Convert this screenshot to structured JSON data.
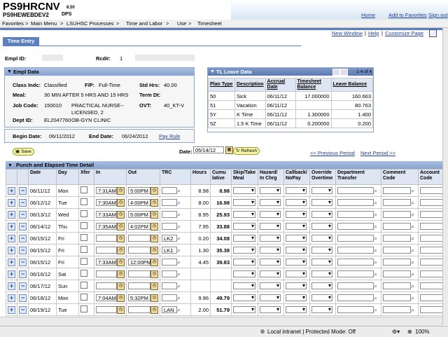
{
  "header": {
    "title": "PS9HRCNV",
    "version": "8.50",
    "database": "PS9HEWEBDEV2",
    "env": "DPS",
    "links": [
      "Home",
      "Add to Favorites",
      "Sign out"
    ]
  },
  "nav": {
    "crumbs": [
      "Favorites",
      "Main Menu",
      "LSUHSC Processes",
      "Time and Labor",
      "Use",
      "Timesheet"
    ],
    "separator": ">"
  },
  "page": {
    "tab_label": "Time Entry",
    "links": [
      "New Window",
      "Help",
      "Customize Page"
    ],
    "empl_id_label": "Empl ID:",
    "rcd_label": "Rcd#:",
    "rcd_value": "1"
  },
  "empl_data": {
    "title": "Empl Data",
    "class_label": "Class Indc:",
    "class_value": "Classified",
    "fp_label": "F/P:",
    "fp_value": "Full-Time",
    "std_label": "Std Hrs:",
    "std_value": "40.00",
    "meal_label": "Meal:",
    "meal_value": "30 MIN AFTER 5 HRS AND 15 HRS",
    "term_label": "Term Dt:",
    "job_label": "Job Code:",
    "job_code": "150010",
    "job_desc_1": "PRACTICAL NURSE--",
    "job_desc_2": "LICENSED, 2",
    "ovt_label": "OVT:",
    "ovt_value": "40_KT-V",
    "dept_label": "Dept ID:",
    "dept_code": "EL2047760",
    "dept_desc": "OB-GYN CLINIC"
  },
  "period": {
    "begin_label": "Begin Date:",
    "begin_value": "06/11/2012",
    "end_label": "End Date:",
    "end_value": "06/24/2012",
    "payrule_link": "Pay Rule"
  },
  "leave": {
    "title": "TL Leave Data",
    "pager": "1-4 of 4",
    "headers": [
      "Plan Type",
      "Description",
      "Accrual Date",
      "Timesheet Balance",
      "Leave Balance"
    ],
    "rows": [
      [
        "50",
        "Sick",
        "06/11/12",
        "17.000000",
        "160.663"
      ],
      [
        "51",
        "Vacation",
        "06/11/12",
        "",
        "80.763"
      ],
      [
        "5Y",
        "K Time",
        "06/11/12",
        "1.300000",
        "1.400"
      ],
      [
        "5Z",
        "1.5 K Time",
        "06/11/12",
        "0.200000",
        "0.200"
      ]
    ]
  },
  "actions": {
    "save": "Save",
    "date_label": "Date:",
    "date_value": "05/14/12",
    "refresh": "Refresh",
    "prev": "<< Previous Period",
    "next": "Next Period >>"
  },
  "punch": {
    "title": "Punch and Elapsed Time Detail",
    "headers": [
      "",
      "",
      "Date",
      "Day",
      "Xfer",
      "In",
      "Out",
      "TRC",
      "Hours",
      "Cumu lative",
      "Skip/Take Meal",
      "Hazard/ In Chrg",
      "Callback/ NoPay",
      "Override Overtime",
      "Department Transfer",
      "Comment Code",
      "Account Code"
    ],
    "rows": [
      {
        "date": "06/11/12",
        "day": "Mon",
        "in": "7:31AM",
        "out": "5:00PM",
        "trc": "",
        "hours": "8.98",
        "cum": "8.98"
      },
      {
        "date": "06/12/12",
        "day": "Tue",
        "in": "7:30AM",
        "out": "4:00PM",
        "trc": "",
        "hours": "8.00",
        "cum": "16.98"
      },
      {
        "date": "06/13/12",
        "day": "Wed",
        "in": "7:33AM",
        "out": "5:00PM",
        "trc": "",
        "hours": "8.95",
        "cum": "25.93"
      },
      {
        "date": "06/14/12",
        "day": "Thu",
        "in": "7:35AM",
        "out": "4:02PM",
        "trc": "",
        "hours": "7.95",
        "cum": "33.88"
      },
      {
        "date": "06/15/12",
        "day": "Fri",
        "in": "",
        "out": "",
        "trc": "LK2",
        "hours": "0.20",
        "cum": "34.08"
      },
      {
        "date": "06/15/12",
        "day": "Fri",
        "in": "",
        "out": "",
        "trc": "LK1",
        "hours": "1.30",
        "cum": "35.38"
      },
      {
        "date": "06/15/12",
        "day": "Fri",
        "in": "7:33AM",
        "out": "12:00PM",
        "trc": "",
        "hours": "4.45",
        "cum": "39.83"
      },
      {
        "date": "06/16/12",
        "day": "Sat",
        "in": "",
        "out": "",
        "trc": "",
        "hours": "",
        "cum": ""
      },
      {
        "date": "06/17/12",
        "day": "Sun",
        "in": "",
        "out": "",
        "trc": "",
        "hours": "",
        "cum": ""
      },
      {
        "date": "06/18/12",
        "day": "Mon",
        "in": "7:04AM",
        "out": "5:32PM",
        "trc": "",
        "hours": "9.96",
        "cum": "49.79"
      },
      {
        "date": "06/19/12",
        "day": "Tue",
        "in": "",
        "out": "",
        "trc": "LAN",
        "hours": "2.00",
        "cum": "51.79"
      }
    ]
  },
  "statusbar": {
    "zone": "Local intranet | Protected Mode: Off",
    "zoom": "100%"
  }
}
